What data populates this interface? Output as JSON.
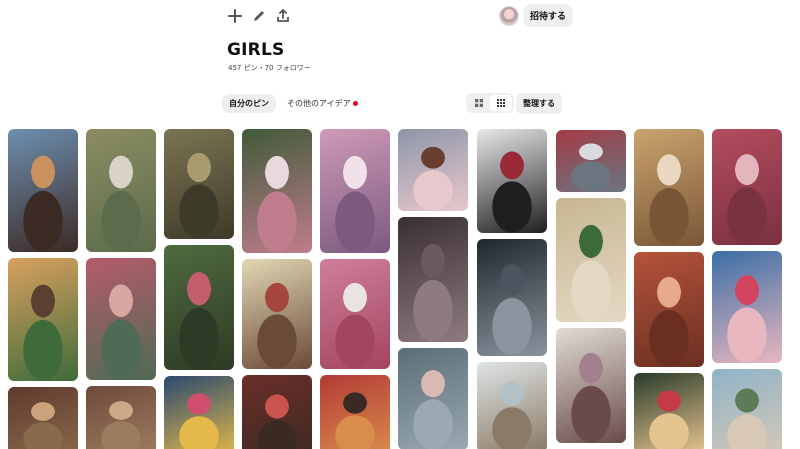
{
  "toolbar": {
    "icons": [
      "plus-icon",
      "pencil-icon",
      "share-icon"
    ]
  },
  "invite": {
    "label": "招待する"
  },
  "board": {
    "title": "GIRLS",
    "stats": "457 ピン・70 フォロワー"
  },
  "tabs": {
    "mine": "自分のピン",
    "ideas": "その他のアイデア"
  },
  "actions": {
    "organize": "整理する"
  },
  "colors": {
    "accent_red": "#e60023",
    "button_gray": "#efefef"
  },
  "pins": [
    {
      "col": 0,
      "row": 0,
      "colors": [
        "#6d8fb0",
        "#c9915e",
        "#3c2a25"
      ]
    },
    {
      "col": 0,
      "row": 1,
      "colors": [
        "#d9a15f",
        "#5b3f31",
        "#3f6b3a"
      ]
    },
    {
      "col": 0,
      "row": 2,
      "colors": [
        "#5e3a2d",
        "#caa27b",
        "#8a6a4c"
      ]
    },
    {
      "col": 1,
      "row": 0,
      "colors": [
        "#8b8c63",
        "#d8d3c6",
        "#5c6b4b"
      ]
    },
    {
      "col": 1,
      "row": 1,
      "colors": [
        "#b65b6a",
        "#d9a7a1",
        "#4f6a55"
      ]
    },
    {
      "col": 1,
      "row": 2,
      "colors": [
        "#6e4a3b",
        "#cda989",
        "#9d7d60"
      ]
    },
    {
      "col": 2,
      "row": 0,
      "colors": [
        "#7b7452",
        "#a99a6f",
        "#3e3a29"
      ]
    },
    {
      "col": 2,
      "row": 1,
      "colors": [
        "#4f6b3f",
        "#c45d6c",
        "#2e3a25"
      ]
    },
    {
      "col": 2,
      "row": 2,
      "colors": [
        "#2b4a6f",
        "#d14f6e",
        "#e4b84a"
      ]
    },
    {
      "col": 3,
      "row": 0,
      "colors": [
        "#3f5a39",
        "#e7d9de",
        "#c07d8d"
      ]
    },
    {
      "col": 3,
      "row": 1,
      "colors": [
        "#e2d7b4",
        "#a5473e",
        "#6a4a38"
      ]
    },
    {
      "col": 3,
      "row": 2,
      "colors": [
        "#6b2e2a",
        "#c9544f",
        "#3a2a22"
      ]
    },
    {
      "col": 4,
      "row": 0,
      "colors": [
        "#cf9ab8",
        "#f1e1e8",
        "#7b5a7d"
      ]
    },
    {
      "col": 4,
      "row": 1,
      "colors": [
        "#cf7f9b",
        "#e9e3e1",
        "#a3455f"
      ]
    },
    {
      "col": 4,
      "row": 2,
      "colors": [
        "#b33b35",
        "#3a2a25",
        "#d98d4c"
      ]
    },
    {
      "col": 5,
      "row": 0,
      "colors": [
        "#8d96a8",
        "#6a3e2e",
        "#e8c8cd"
      ]
    },
    {
      "col": 5,
      "row": 1,
      "colors": [
        "#3a2f33",
        "#6d5a5f",
        "#8e7b80"
      ]
    },
    {
      "col": 5,
      "row": 2,
      "colors": [
        "#5b6d78",
        "#d8b9b3",
        "#9aa9b2"
      ]
    },
    {
      "col": 6,
      "row": 0,
      "colors": [
        "#e9e7ea",
        "#9a2a3a",
        "#1f1f22"
      ]
    },
    {
      "col": 6,
      "row": 1,
      "colors": [
        "#20262d",
        "#4b5560",
        "#8a949e"
      ]
    },
    {
      "col": 6,
      "row": 2,
      "colors": [
        "#dfe4e6",
        "#b2c2c8",
        "#8a7a66"
      ]
    },
    {
      "col": 7,
      "row": 0,
      "colors": [
        "#a33b45",
        "#d8dadd",
        "#6a7580"
      ]
    },
    {
      "col": 7,
      "row": 1,
      "colors": [
        "#c8b691",
        "#3d6a3a",
        "#e4d9c4"
      ]
    },
    {
      "col": 7,
      "row": 2,
      "colors": [
        "#e1dcd5",
        "#a2808c",
        "#6a4b4a"
      ]
    },
    {
      "col": 7,
      "row": 3,
      "colors": [
        "#e8a9bb",
        "#f2d1da",
        "#d07d95"
      ]
    },
    {
      "col": 8,
      "row": 0,
      "colors": [
        "#c9a46e",
        "#e9d7c0",
        "#7a5637"
      ]
    },
    {
      "col": 8,
      "row": 1,
      "colors": [
        "#b5533b",
        "#e7a98b",
        "#6b2f22"
      ]
    },
    {
      "col": 8,
      "row": 2,
      "colors": [
        "#2a3b2a",
        "#c53a44",
        "#e6c48f"
      ]
    },
    {
      "col": 9,
      "row": 0,
      "colors": [
        "#b34c5d",
        "#e3b5bc",
        "#7a3140"
      ]
    },
    {
      "col": 9,
      "row": 1,
      "colors": [
        "#3a6ea5",
        "#d2445f",
        "#e9b7c0"
      ]
    },
    {
      "col": 9,
      "row": 2,
      "colors": [
        "#8fb3c9",
        "#5e7b58",
        "#d7c9b5"
      ]
    }
  ]
}
